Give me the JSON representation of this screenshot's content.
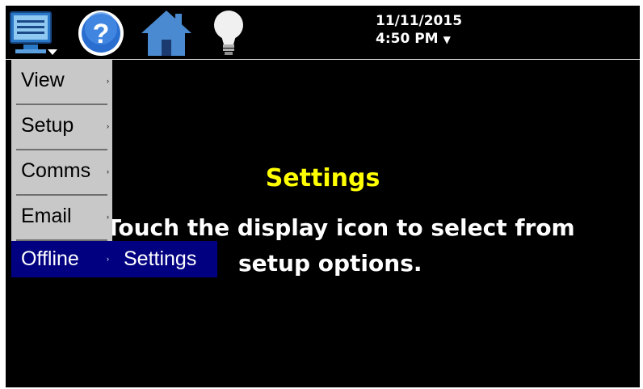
{
  "toolbar": {
    "menu_icon": "display-monitor-icon",
    "help_icon": "help-question-icon",
    "home_icon": "home-icon",
    "bulb_icon": "lightbulb-icon"
  },
  "datetime": {
    "date": "11/11/2015",
    "time": "4:50 PM",
    "dropdown_arrow": "▼"
  },
  "content": {
    "title": "Settings",
    "line1": "Touch the display icon to select from",
    "line2": "setup options."
  },
  "menu": {
    "items": [
      {
        "label": "View",
        "arrow": "›"
      },
      {
        "label": "Setup",
        "arrow": "›"
      },
      {
        "label": "Comms",
        "arrow": "›"
      },
      {
        "label": "Email",
        "arrow": "›"
      },
      {
        "label": "Offline",
        "arrow": "›"
      }
    ],
    "submenu_item": "Settings"
  },
  "colors": {
    "background": "#000000",
    "title": "#ffff00",
    "menu_bg": "#c8c8c8",
    "highlight": "#000080"
  }
}
